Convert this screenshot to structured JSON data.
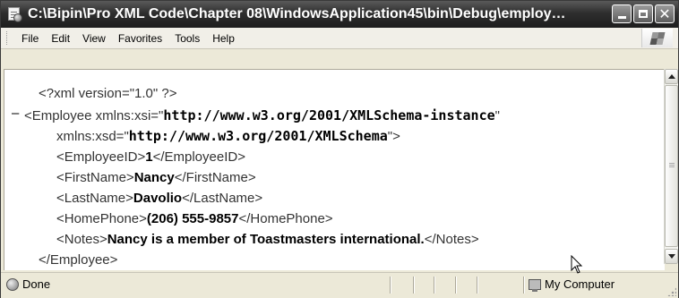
{
  "window": {
    "title": "C:\\Bipin\\Pro XML Code\\Chapter 08\\WindowsApplication45\\bin\\Debug\\employ…"
  },
  "menu": {
    "items": [
      "File",
      "Edit",
      "View",
      "Favorites",
      "Tools",
      "Help"
    ]
  },
  "xml": {
    "decl": "<?xml version=\"1.0\" ?>",
    "collapse_marker": "–",
    "employee_open_prefix": "<Employee xmlns:xsi=\"",
    "xsi_value": "http://www.w3.org/2001/XMLSchema-instance",
    "quote_close": "\"",
    "xsd_prefix": "xmlns:xsd=\"",
    "xsd_value": "http://www.w3.org/2001/XMLSchema",
    "xsd_suffix": "\">",
    "employee_id_open": "<EmployeeID>",
    "employee_id_value": "1",
    "employee_id_close": "</EmployeeID>",
    "first_name_open": "<FirstName>",
    "first_name_value": "Nancy",
    "first_name_close": "</FirstName>",
    "last_name_open": "<LastName>",
    "last_name_value": "Davolio",
    "last_name_close": "</LastName>",
    "home_phone_open": "<HomePhone>",
    "home_phone_value": "(206) 555-9857",
    "home_phone_close": "</HomePhone>",
    "notes_open": "<Notes>",
    "notes_value": "Nancy is a member of Toastmasters international.",
    "notes_close": "</Notes>",
    "employee_close": "</Employee>"
  },
  "status": {
    "left": "Done",
    "zone": "My Computer"
  }
}
